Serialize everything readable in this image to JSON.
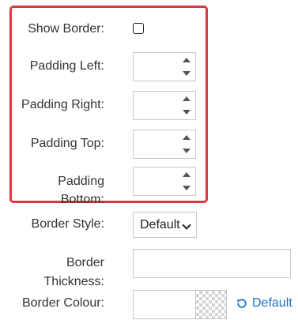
{
  "fields": {
    "show_border": {
      "label": "Show Border:",
      "checked": false
    },
    "padding_left": {
      "label": "Padding Left:",
      "value": ""
    },
    "padding_right": {
      "label": "Padding Right:",
      "value": ""
    },
    "padding_top": {
      "label": "Padding Top:",
      "value": ""
    },
    "padding_bottom": {
      "label_line1": "Padding",
      "label_line2": "Bottom:",
      "value": ""
    },
    "border_style": {
      "label": "Border Style:",
      "selected": "Default"
    },
    "border_thickness": {
      "label_line1": "Border",
      "label_line2": "Thickness:",
      "value": ""
    },
    "border_colour": {
      "label": "Border Colour:",
      "value": "",
      "reset_label": "Default"
    }
  },
  "colors": {
    "highlight_border": "#e0373f",
    "link": "#1a73c8"
  },
  "icons": {
    "reset": "reset-icon",
    "dropdown": "chevron-down-icon"
  }
}
